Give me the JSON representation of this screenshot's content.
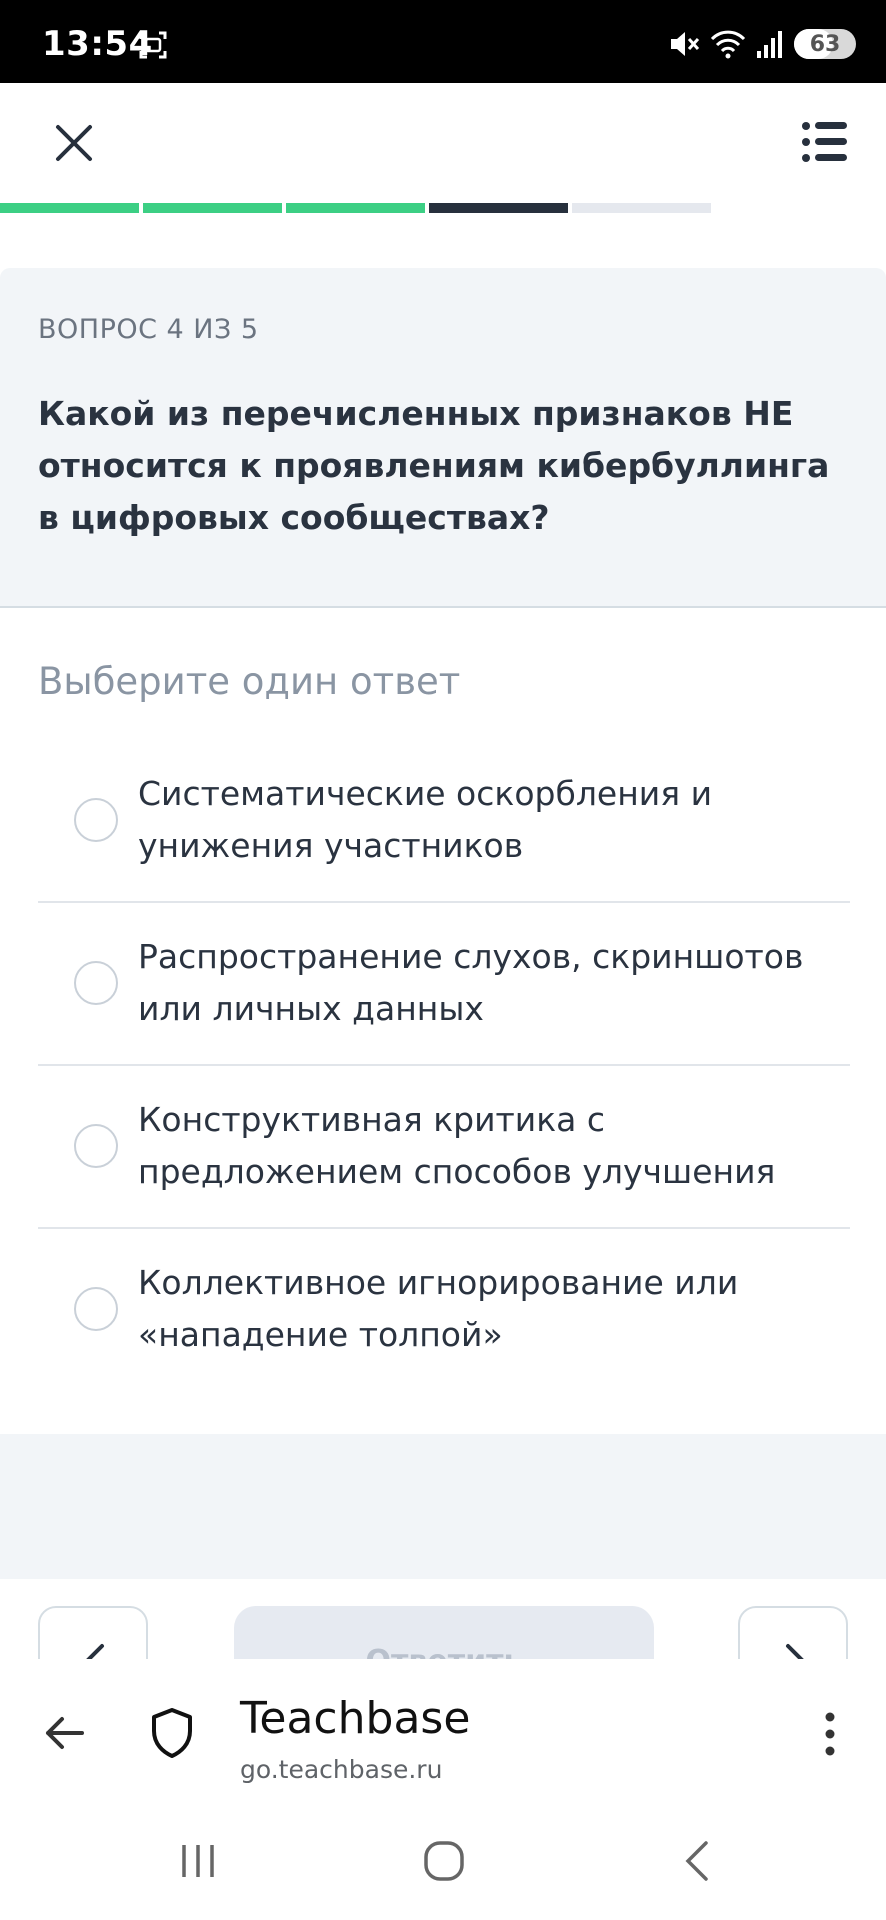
{
  "status_bar": {
    "time": "13:54",
    "battery": "63",
    "battery_level": 0.63
  },
  "header": {
    "close_icon": "close-icon",
    "menu_icon": "list-icon"
  },
  "progress": {
    "total": 5,
    "current": 4,
    "completed_color": "#3ccf84",
    "current_color": "#27303d",
    "pending_color": "#e5e8ee"
  },
  "question": {
    "counter": "ВОПРОС 4 ИЗ 5",
    "text": "Какой из перечисленных признаков НЕ относится к проявлениям кибербуллинга в цифровых сообществах?"
  },
  "instruction": "Выберите один ответ",
  "answers": [
    {
      "label": "Систематические оскорбления и унижения участников"
    },
    {
      "label": "Распространение слухов, скриншотов или личных данных"
    },
    {
      "label": "Конструктивная критика с предложением способов улучшения"
    },
    {
      "label": "Коллективное игнорирование или «нападение толпой»"
    }
  ],
  "controls": {
    "answer_button": "Ответить"
  },
  "browser": {
    "site_title": "Teachbase",
    "site_url": "go.teachbase.ru"
  }
}
